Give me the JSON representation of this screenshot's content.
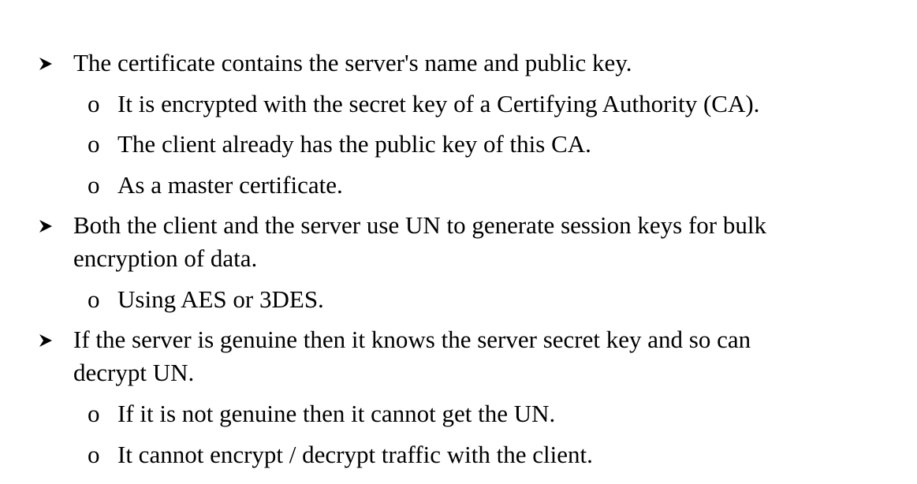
{
  "document": {
    "bullet_arrow": "arrow-bullet-icon",
    "bullet_circle": "o",
    "items": [
      {
        "level": 1,
        "lines": [
          "The certificate contains the server's name and public key."
        ]
      },
      {
        "level": 2,
        "lines": [
          "It is encrypted with the secret key of a Certifying Authority (CA)."
        ]
      },
      {
        "level": 2,
        "lines": [
          "The client already has the public key of this CA."
        ]
      },
      {
        "level": 2,
        "lines": [
          "As a master certificate."
        ]
      },
      {
        "level": 1,
        "lines": [
          "Both the client and the server use UN to generate session keys for bulk",
          "encryption of data."
        ]
      },
      {
        "level": 2,
        "lines": [
          "Using AES or 3DES."
        ]
      },
      {
        "level": 1,
        "lines": [
          "If the server is genuine then it knows the server secret key and so can",
          "decrypt UN."
        ]
      },
      {
        "level": 2,
        "lines": [
          "If it is not genuine then it cannot get the UN."
        ]
      },
      {
        "level": 2,
        "lines": [
          "It cannot encrypt / decrypt traffic with the client."
        ]
      }
    ]
  }
}
